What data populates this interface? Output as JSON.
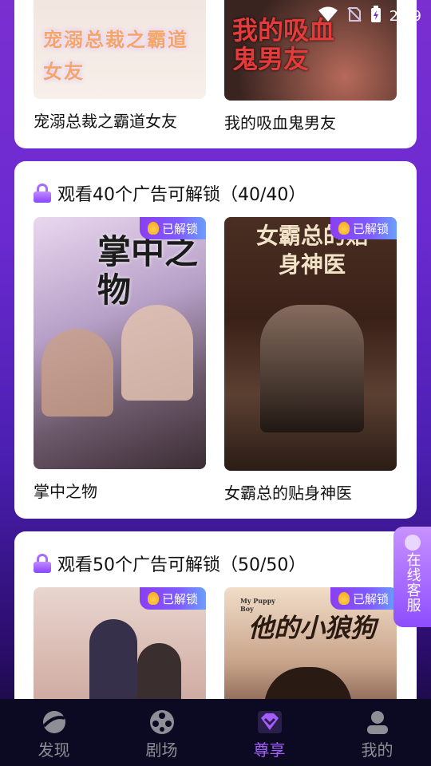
{
  "status": {
    "time": "2:39"
  },
  "top_card": {
    "items": [
      {
        "title": "宠溺总裁之霸道女友",
        "poster_text": "宠溺总裁之霸道女友"
      },
      {
        "title": "我的吸血鬼男友",
        "poster_text": "我的吸血鬼男友"
      }
    ]
  },
  "section1": {
    "heading": "观看40个广告可解锁（40/40）",
    "items": [
      {
        "title": "掌中之物",
        "badge": "已解锁",
        "poster_text": "掌中之物"
      },
      {
        "title": "女霸总的贴身神医",
        "badge": "已解锁",
        "poster_text": "女霸总的贴身神医"
      }
    ]
  },
  "section2": {
    "heading": "观看50个广告可解锁（50/50）",
    "items": [
      {
        "badge": "已解锁"
      },
      {
        "badge": "已解锁",
        "poster_text": "他的小狼狗",
        "poster_sub": "My Puppy Boy"
      }
    ]
  },
  "float_service": {
    "label": "在线客服"
  },
  "tabbar": {
    "tabs": [
      {
        "label": "发现",
        "icon": "discover-icon",
        "active": false
      },
      {
        "label": "剧场",
        "icon": "film-reel-icon",
        "active": false
      },
      {
        "label": "尊享",
        "icon": "vip-diamond-icon",
        "active": true
      },
      {
        "label": "我的",
        "icon": "profile-icon",
        "active": false
      }
    ]
  }
}
